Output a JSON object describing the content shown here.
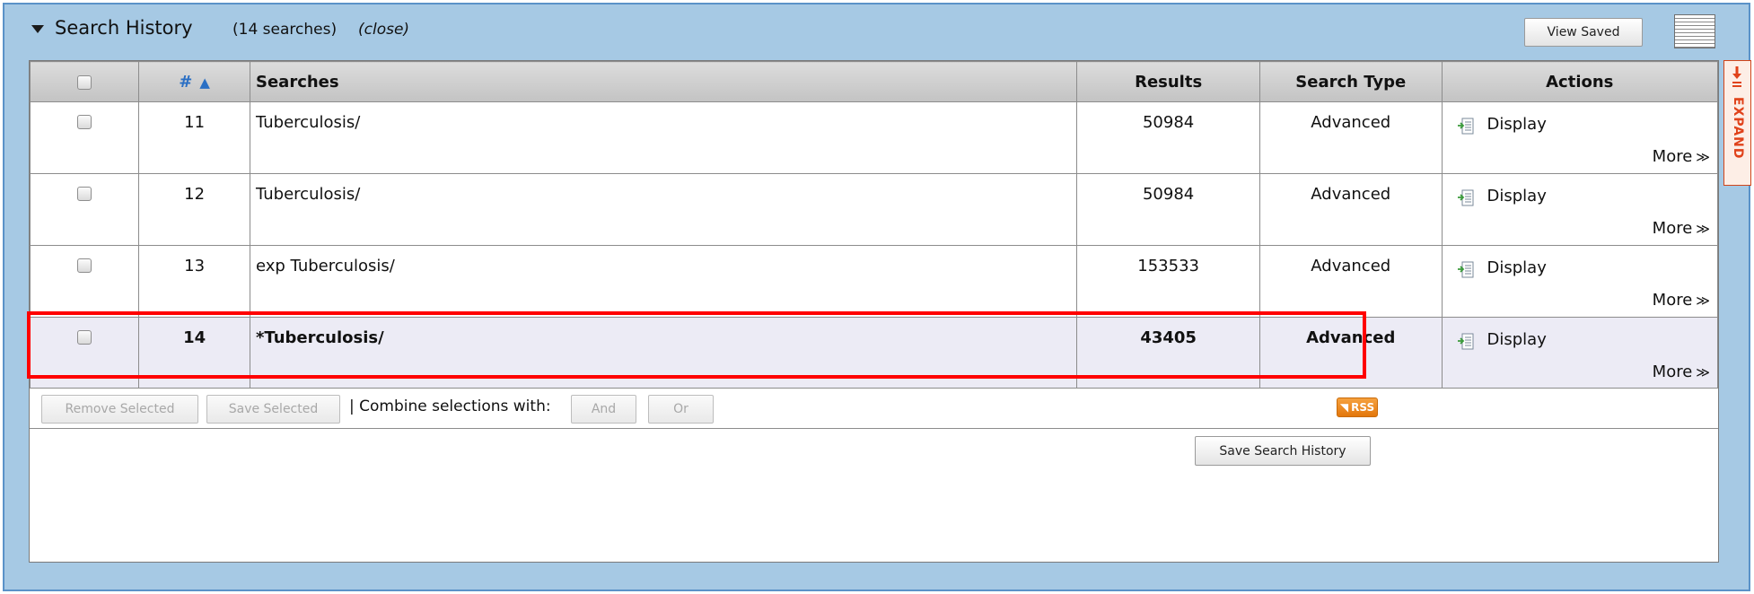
{
  "header": {
    "title": "Search History",
    "count_text": "(14 searches)",
    "close_label": "(close)",
    "view_saved_label": "View Saved"
  },
  "table": {
    "columns": [
      "#",
      "Searches",
      "Results",
      "Search Type",
      "Actions"
    ],
    "sort_indicator": "▲",
    "rows": [
      {
        "num": "11",
        "search": "Tuberculosis/",
        "results": "50984",
        "type": "Advanced",
        "display_label": "Display",
        "more_label": "More",
        "selected": false
      },
      {
        "num": "12",
        "search": "Tuberculosis/",
        "results": "50984",
        "type": "Advanced",
        "display_label": "Display",
        "more_label": "More",
        "selected": false
      },
      {
        "num": "13",
        "search": "exp Tuberculosis/",
        "results": "153533",
        "type": "Advanced",
        "display_label": "Display",
        "more_label": "More",
        "selected": false
      },
      {
        "num": "14",
        "search": "*Tuberculosis/",
        "results": "43405",
        "type": "Advanced",
        "display_label": "Display",
        "more_label": "More",
        "selected": true
      }
    ]
  },
  "toolbar": {
    "remove_selected_label": "Remove Selected",
    "save_selected_label": "Save Selected",
    "combine_label": "| Combine selections with:",
    "and_label": "And",
    "or_label": "Or",
    "rss_label": "RSS"
  },
  "footer": {
    "save_history_label": "Save Search History"
  },
  "side": {
    "expand_label": "EXPAND"
  },
  "colors": {
    "panel_bg": "#a6c9e4",
    "highlight_border": "#ff0000",
    "selected_row_bg": "#ecebf5",
    "rss_orange": "#e3770b",
    "expand_red": "#e0421a",
    "sort_arrow": "#2a6fc4"
  },
  "icons": {
    "collapse": "triangle-down-icon",
    "columns_toggle": "lines-icon",
    "display": "document-arrow-icon",
    "more": "double-chevron-right-icon",
    "rss": "rss-feed-icon",
    "expand": "arrow-down-icon"
  }
}
